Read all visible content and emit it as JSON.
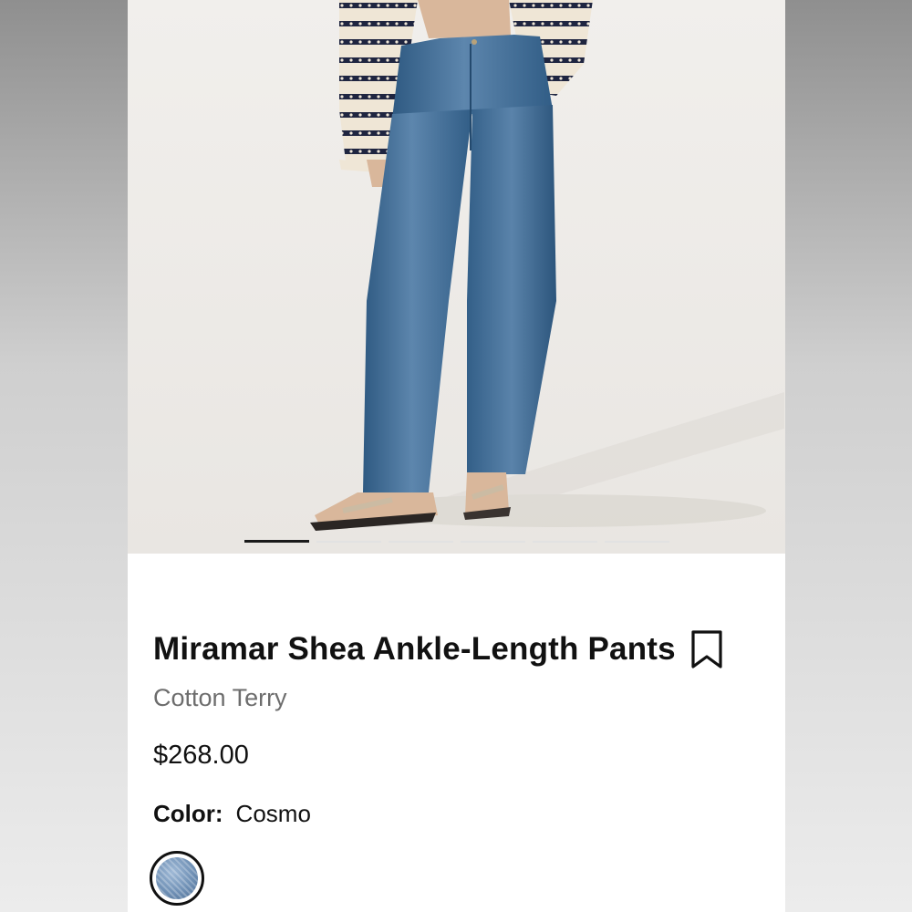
{
  "product": {
    "name": "Miramar Shea Ankle-Length Pants",
    "fabric": "Cotton Terry",
    "price": "$268.00",
    "color_label": "Color:",
    "color_value": "Cosmo"
  },
  "gallery": {
    "image_count": 6,
    "active_index": 0
  },
  "colors": {
    "text_primary": "#111111",
    "text_secondary": "#6d6d6d",
    "denim": "#3f6e98",
    "background": "#efedea"
  },
  "icons": {
    "bookmark": "bookmark-icon"
  }
}
